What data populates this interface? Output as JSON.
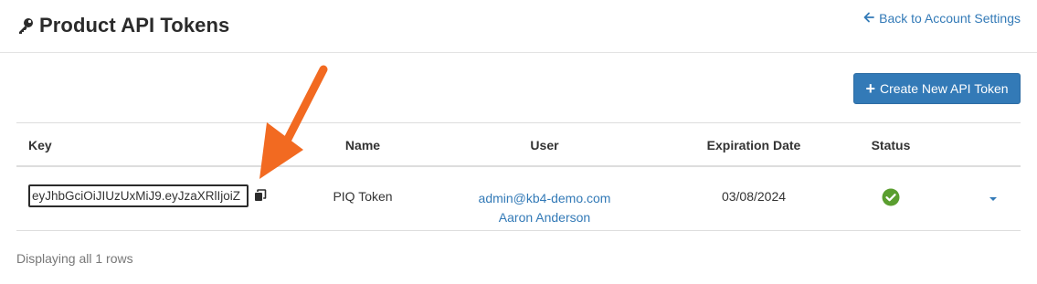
{
  "header": {
    "title": "Product API Tokens",
    "title_icon": "key-icon",
    "back_link": "Back to Account Settings",
    "back_icon": "arrow-left-icon"
  },
  "toolbar": {
    "create_label": "Create New API Token",
    "create_icon": "plus-icon"
  },
  "table": {
    "columns": [
      "Key",
      "Name",
      "User",
      "Expiration Date",
      "Status"
    ],
    "rows": [
      {
        "key": "eyJhbGciOiJIUzUxMiJ9.eyJzaXRlIjoiZ",
        "copy_icon": "copy-icon",
        "name": "PIQ Token",
        "user_email": "admin@kb4-demo.com",
        "user_name": "Aaron Anderson",
        "expiration": "03/08/2024",
        "status_icon": "check-circle-icon",
        "actions_icon": "caret-down-icon"
      }
    ]
  },
  "footer": {
    "row_count_text": "Displaying all 1 rows"
  },
  "annotation": {
    "arrow_icon": "orange-arrow-icon"
  },
  "colors": {
    "link": "#337ab7",
    "primary_button": "#337ab7",
    "status_ok": "#5a9e2f",
    "annotation": "#f26a21"
  }
}
